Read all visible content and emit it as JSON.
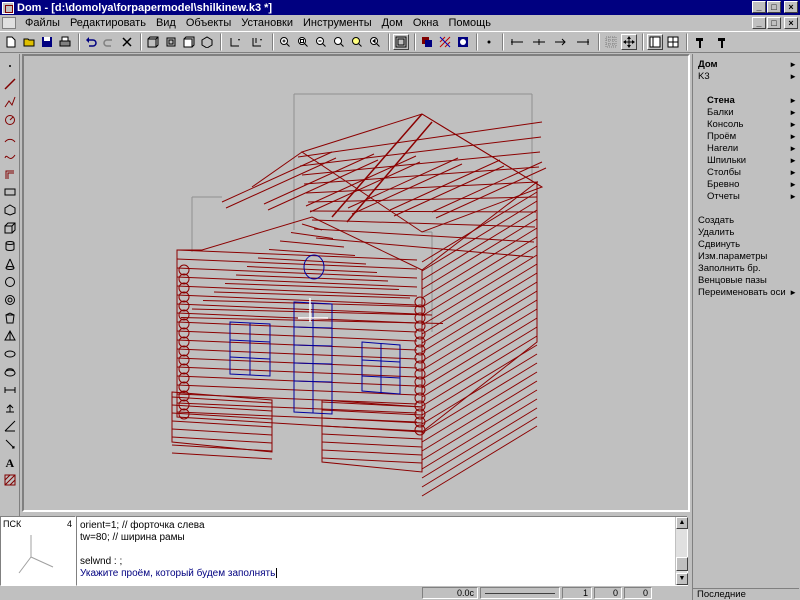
{
  "window": {
    "title": "Dom - [d:\\domolya\\forpapermodel\\shilkinew.k3 *]",
    "minimize": "_",
    "maximize": "□",
    "close": "×"
  },
  "menu": {
    "items": [
      "Файлы",
      "Редактировать",
      "Вид",
      "Объекты",
      "Установки",
      "Инструменты",
      "Дом",
      "Окна",
      "Помощь"
    ]
  },
  "right_panel": {
    "header_items": [
      {
        "label": "Дом",
        "arrow": "►"
      },
      {
        "label": "K3",
        "arrow": "►"
      }
    ],
    "submenu_items": [
      {
        "label": "Стена",
        "arrow": "►"
      },
      {
        "label": "Балки",
        "arrow": "►"
      },
      {
        "label": "Консоль",
        "arrow": "►"
      },
      {
        "label": "Проём",
        "arrow": "►"
      },
      {
        "label": "Нагели",
        "arrow": "►"
      },
      {
        "label": "Шпильки",
        "arrow": "►"
      },
      {
        "label": "Столбы",
        "arrow": "►"
      },
      {
        "label": "Бревно",
        "arrow": "►"
      },
      {
        "label": "Отчеты",
        "arrow": "►"
      }
    ],
    "commands": [
      {
        "label": "Создать"
      },
      {
        "label": "Удалить"
      },
      {
        "label": "Сдвинуть"
      },
      {
        "label": "Изм.параметры"
      },
      {
        "label": "Заполнить бр."
      },
      {
        "label": "Венцовые пазы"
      },
      {
        "label": "Переименовать оси",
        "arrow": "►"
      }
    ],
    "footer": "Последние"
  },
  "console": {
    "coord_label": "ПСК",
    "coord_number": "4",
    "lines": [
      "orient=1; // форточка слева",
      "tw=80;  // ширина рамы",
      "",
      "selwnd : ;",
      "Укажите проём, который будем заполнять"
    ]
  },
  "status": {
    "cells": [
      "",
      "0.0c",
      "",
      "1",
      "0",
      "0"
    ]
  },
  "colors": {
    "title_bar": "#000080",
    "model_lines": "#8b0000",
    "selected_lines": "#0000a0",
    "viewport_bg": "#c0c0c0"
  }
}
